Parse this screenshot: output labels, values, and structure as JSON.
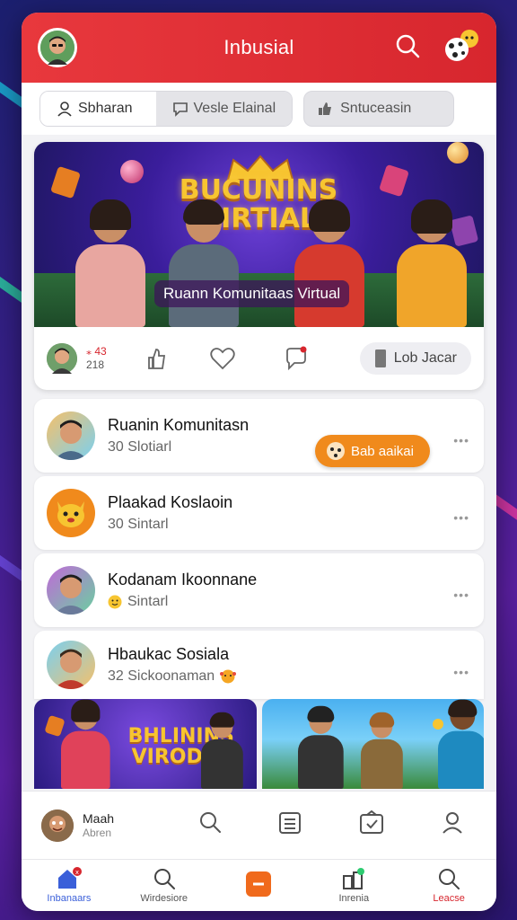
{
  "app": {
    "title": "Inbusial"
  },
  "tabs": [
    {
      "label": "Sbharan",
      "icon": "user-icon",
      "active": true
    },
    {
      "label": "Vesle Elainal",
      "icon": "chat-icon",
      "active": false
    },
    {
      "label": "Sntuceasin",
      "icon": "thumb-icon",
      "active": false
    }
  ],
  "feature": {
    "banner_logo": "BUCUNINS VIRTIAL",
    "caption": "Ruann Komunitaas Virtual",
    "stat_top": "⁎ 43",
    "stat_bottom": "218",
    "lob_label": "Lob Jacar"
  },
  "list": [
    {
      "title": "Ruanin Komunitasn",
      "sub": "30 Slotiarl",
      "badge": "Bab aaikai",
      "avatar": "man-avatar"
    },
    {
      "title": "Plaakad Koslaoin",
      "sub": "30 Sintarl",
      "avatar": "fox-avatar"
    },
    {
      "title": "Kodanam Ikoonnane",
      "sub": "Sintarl",
      "avatar": "man-avatar"
    },
    {
      "title": "Hbaukac Sosiala",
      "sub": "32 Sickoonaman",
      "avatar": "man-avatar"
    }
  ],
  "thumbs": [
    {
      "logo": "BHLININS VIRODAL"
    },
    {
      "logo": ""
    }
  ],
  "profile": {
    "name": "Maah",
    "sub": "Abren"
  },
  "nav": [
    {
      "label": "Inbanaars",
      "icon": "home-icon",
      "state": "active"
    },
    {
      "label": "Wirdesiore",
      "icon": "search-icon",
      "state": "normal"
    },
    {
      "label": "",
      "icon": "add-icon",
      "state": "center"
    },
    {
      "label": "Inrenia",
      "icon": "apps-icon",
      "state": "normal"
    },
    {
      "label": "Leacse",
      "icon": "search-icon",
      "state": "red"
    }
  ],
  "colors": {
    "header": "#e8383d",
    "accent_orange": "#f08a1c",
    "nav_active": "#3a5fd9"
  }
}
